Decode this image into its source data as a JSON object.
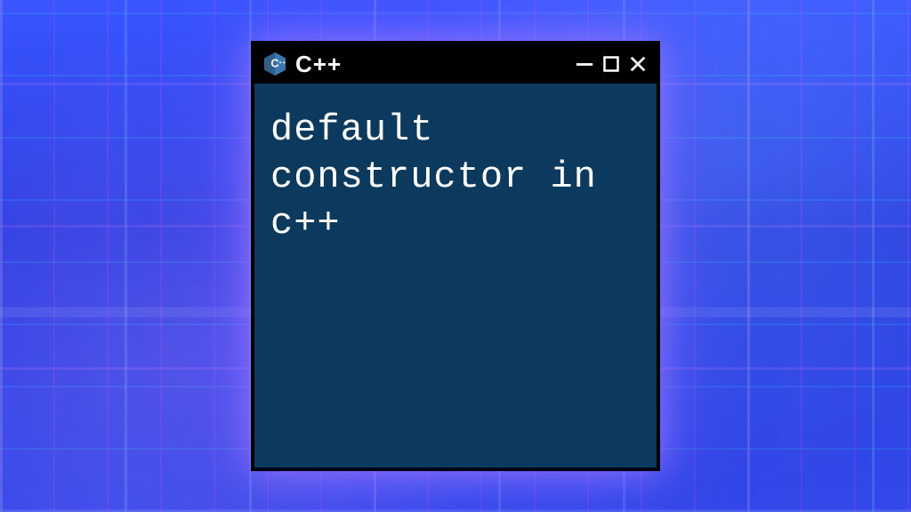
{
  "window": {
    "title": "C++",
    "logo_name": "cpp-logo-icon",
    "content": "default constructor in c++",
    "controls": {
      "minimize": "minimize-icon",
      "maximize": "maximize-icon",
      "close": "close-icon"
    }
  },
  "colors": {
    "window_bg": "#0b3a5e",
    "chrome": "#000000",
    "text": "#ffffff"
  }
}
